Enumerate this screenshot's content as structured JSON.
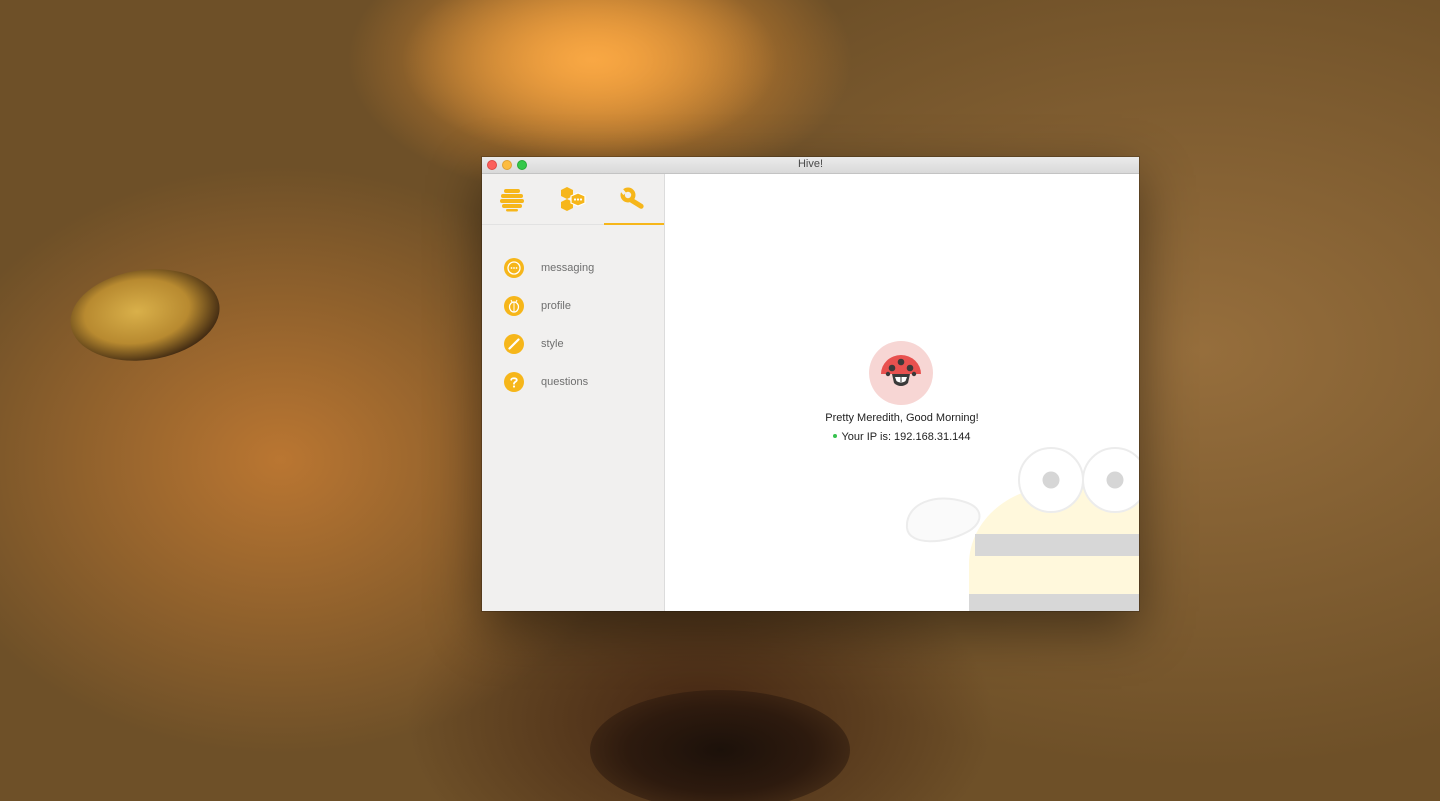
{
  "window": {
    "title": "Hive!"
  },
  "sidebar": {
    "tabs": [
      {
        "name": "hive-icon"
      },
      {
        "name": "cells-chat-icon"
      },
      {
        "name": "wrench-icon",
        "active": true
      }
    ],
    "items": [
      {
        "label": "messaging",
        "icon": "ellipsis-icon"
      },
      {
        "label": "profile",
        "icon": "bug-icon"
      },
      {
        "label": "style",
        "icon": "pencil-icon"
      },
      {
        "label": "questions",
        "icon": "question-icon"
      }
    ]
  },
  "main": {
    "avatar_icon": "ladybug-icon",
    "greeting": "Pretty Meredith, Good Morning!",
    "ip_text": "Your IP is: 192.168.31.144",
    "status": "online"
  },
  "colors": {
    "accent": "#f6b61a",
    "sidebar_bg": "#f1f0ef",
    "avatar_bg": "#f7d6d4",
    "ladybug_red": "#e8514f",
    "online": "#36c24e"
  }
}
